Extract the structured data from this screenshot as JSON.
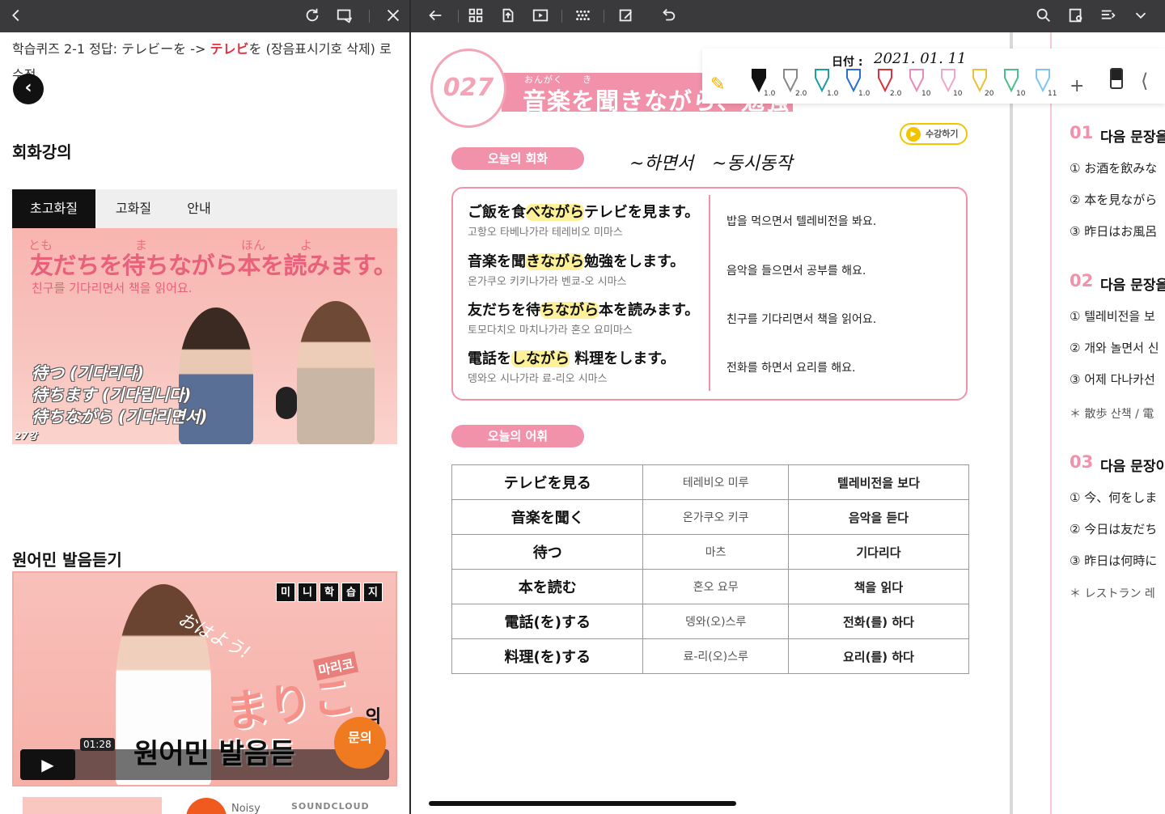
{
  "left_panel": {
    "notice_prefix": "학습퀴즈 2-1 정답: テレビーを -> ",
    "notice_bold": "テレビ",
    "notice_suffix": "を (장음표시기호 삭제) 로 수정.",
    "section_conversation": "회화강의",
    "tabs": [
      "초고화질",
      "고화질",
      "안내"
    ],
    "video1": {
      "ruby": [
        "とも",
        "ま",
        "ほん",
        "よ"
      ],
      "sentence": "友だちを待ちながら本を読みます。",
      "translation": "친구를 기다리면서 책을 읽어요.",
      "lines": [
        "待つ (기다리다)",
        "待ちます (기다립니다)",
        "待ちながら (기다리면서)"
      ],
      "episode": "27강"
    },
    "section_native": "원어민 발음듣기",
    "video2": {
      "badge": [
        "미",
        "니",
        "학",
        "습",
        "지"
      ],
      "greeting": "おはよう!",
      "name_kr": "마리코",
      "name_jp": "まりこ",
      "particle": "의",
      "subtitle": "원어민 발음듣",
      "time": "01:28",
      "inquiry": "문의"
    },
    "soundcloud_user": "Noisy",
    "soundcloud_brand": "SOUNDCLOUD"
  },
  "page": {
    "unit": "027",
    "title": "音楽を聞きながら、勉強をします",
    "title_ruby": "おんがく　　き",
    "date_label": "日付 :",
    "date_value": "2021. 01. 11",
    "pen_sizes": [
      "1.0",
      "2.0",
      "1.0",
      "1.0",
      "2.0",
      "10",
      "10",
      "20",
      "10",
      "11"
    ],
    "lecture_button": "수강하기",
    "today_conversation": "오늘의 회화",
    "today_vocab": "오늘의 어휘",
    "handwriting": [
      "~하면서",
      "~동시동작"
    ],
    "dialogue": [
      {
        "jp_pre": "ご飯を食",
        "jp_hl": "べながら",
        "jp_post": "テレビを見ます。",
        "reading": "고항오 타베나가라 테레비오 미마스",
        "kr": "밥을 먹으면서 텔레비전을 봐요."
      },
      {
        "jp_pre": "音楽を聞",
        "jp_hl": "きながら",
        "jp_post": "勉強をします。",
        "reading": "온가쿠오 키키나가라 벤쿄-오 시마스",
        "kr": "음악을 들으면서 공부를 해요."
      },
      {
        "jp_pre": "友だちを待",
        "jp_hl": "ちながら",
        "jp_post": "本を読みます。",
        "reading": "토모다치오 마치나가라 혼오 요미마스",
        "kr": "친구를 기다리면서 책을 읽어요."
      },
      {
        "jp_pre": "電話を",
        "jp_hl": "しながら",
        "jp_post": " 料理をします。",
        "reading": "뎅와오 시나가라 료-리오 시마스",
        "kr": "전화를 하면서 요리를 해요."
      }
    ],
    "vocab": [
      {
        "jp": "テレビを見る",
        "reading": "테레비오 미루",
        "kr": "텔레비전을 보다"
      },
      {
        "jp": "音楽を聞く",
        "reading": "온가쿠오 키쿠",
        "kr": "음악을 듣다"
      },
      {
        "jp": "待つ",
        "reading": "마츠",
        "kr": "기다리다"
      },
      {
        "jp": "本を読む",
        "reading": "혼오 요무",
        "kr": "책을 읽다"
      },
      {
        "jp": "電話(を)する",
        "reading": "뎅와(오)스루",
        "kr": "전화(를) 하다"
      },
      {
        "jp": "料理(を)する",
        "reading": "료-리(오)스루",
        "kr": "요리(를) 하다"
      }
    ]
  },
  "next_page": {
    "q1": {
      "num": "01",
      "head": "다음 문장을",
      "items": [
        "① お酒を飲みな",
        "② 本を見ながら",
        "③ 昨日はお風呂"
      ]
    },
    "q2": {
      "num": "02",
      "head": "다음 문장을",
      "items": [
        "① 텔레비전을 보",
        "② 개와 놀면서 신",
        "③ 어제 다나카선"
      ],
      "note": "＊ 散歩 산책 / 電"
    },
    "q3": {
      "num": "03",
      "head": "다음 문장이",
      "items": [
        "① 今、何をしま",
        "② 今日は友だち",
        "③ 昨日は何時に"
      ],
      "note": "＊ レストラン 레"
    }
  },
  "colors": {
    "accent_pink": "#f291aa",
    "highlight": "#fff09a",
    "toolbar": "#3a3a3c"
  }
}
